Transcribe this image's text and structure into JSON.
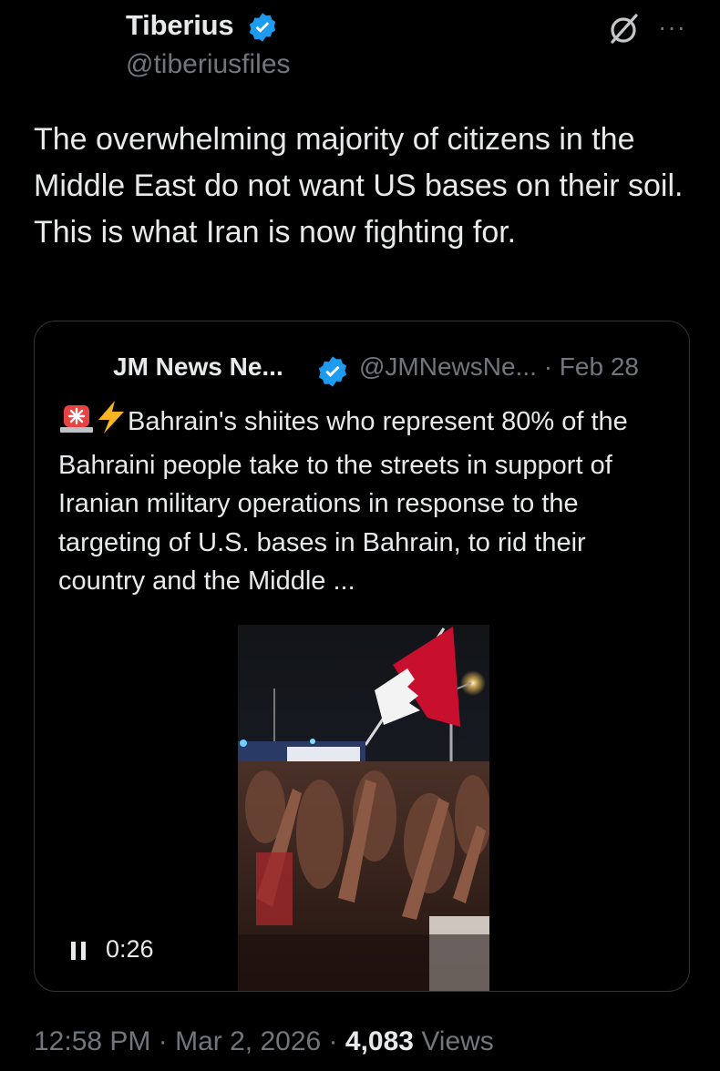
{
  "tweet": {
    "author_name": "Tiberius",
    "author_handle": "@tiberiusfiles",
    "verified_color": "#1d9bf0",
    "icons": {
      "grok": "grok-icon",
      "more": "more-horizontal-icon"
    },
    "more_label": "···",
    "text": "The overwhelming majority of citizens in the Middle East do not want US bases on their soil. This is what Iran is now fighting for."
  },
  "quote": {
    "author_name": "JM News Ne...",
    "author_handle": "@JMNewsNe...",
    "separator": "·",
    "date": "Feb 28",
    "emojis": [
      "siren-emoji",
      "lightning-emoji"
    ],
    "text": "Bahrain's shiites who represent 80% of the Bahraini people take to the streets in support of Iranian military operations in response to the targeting of U.S. bases in Bahrain, to rid their country and the Middle ...",
    "video": {
      "state": "playing",
      "time": "0:26",
      "description_icon": "pause-icon"
    }
  },
  "footer": {
    "time": "12:58 PM",
    "separator": "·",
    "date": "Mar 2, 2026",
    "views_count": "4,083",
    "views_label": "Views"
  }
}
